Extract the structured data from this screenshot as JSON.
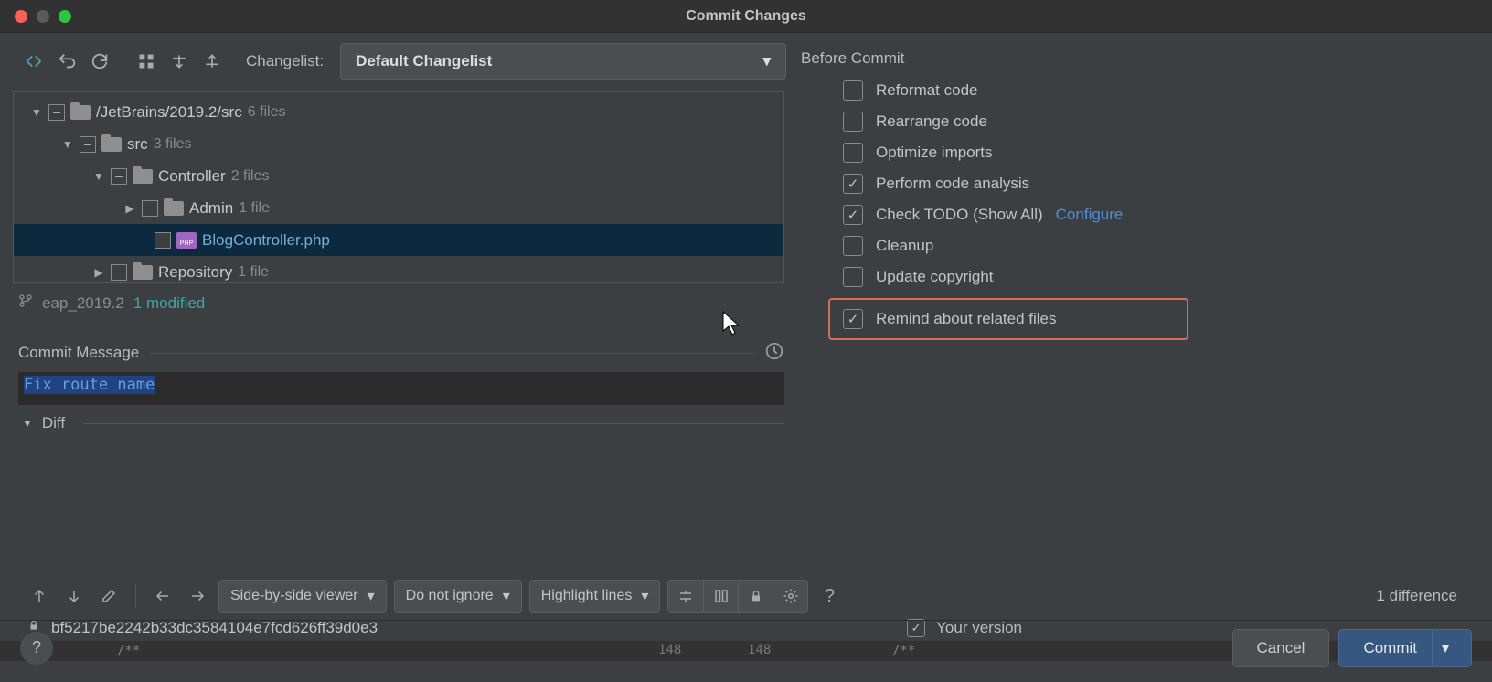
{
  "window": {
    "title": "Commit Changes"
  },
  "toolbar": {
    "changelist_label": "Changelist:",
    "changelist_value": "Default Changelist"
  },
  "tree": {
    "root": {
      "path": "/JetBrains/2019.2/src",
      "count": "6 files"
    },
    "src": {
      "name": "src",
      "count": "3 files"
    },
    "controller": {
      "name": "Controller",
      "count": "2 files"
    },
    "admin": {
      "name": "Admin",
      "count": "1 file"
    },
    "blog": {
      "name": "BlogController.php"
    },
    "repo": {
      "name": "Repository",
      "count": "1 file"
    }
  },
  "branch": {
    "name": "eap_2019.2",
    "status": "1 modified"
  },
  "commit_message": {
    "label": "Commit Message",
    "value": "Fix route name"
  },
  "diff": {
    "label": "Diff"
  },
  "before_commit": {
    "label": "Before Commit",
    "reformat": "Reformat code",
    "rearrange": "Rearrange code",
    "optimize": "Optimize imports",
    "analysis": "Perform code analysis",
    "todo": "Check TODO (Show All)",
    "configure": "Configure",
    "cleanup": "Cleanup",
    "copyright": "Update copyright",
    "remind": "Remind about related files"
  },
  "diff_toolbar": {
    "viewer": "Side-by-side viewer",
    "ignore": "Do not ignore",
    "highlight": "Highlight lines",
    "diff_count": "1 difference"
  },
  "version": {
    "left_hash": "bf5217be2242b33dc3584104e7fcd626ff39d0e3",
    "your_version": "Your version",
    "line_left": "148",
    "line_right": "148",
    "comment": "/**"
  },
  "footer": {
    "cancel": "Cancel",
    "commit": "Commit"
  }
}
